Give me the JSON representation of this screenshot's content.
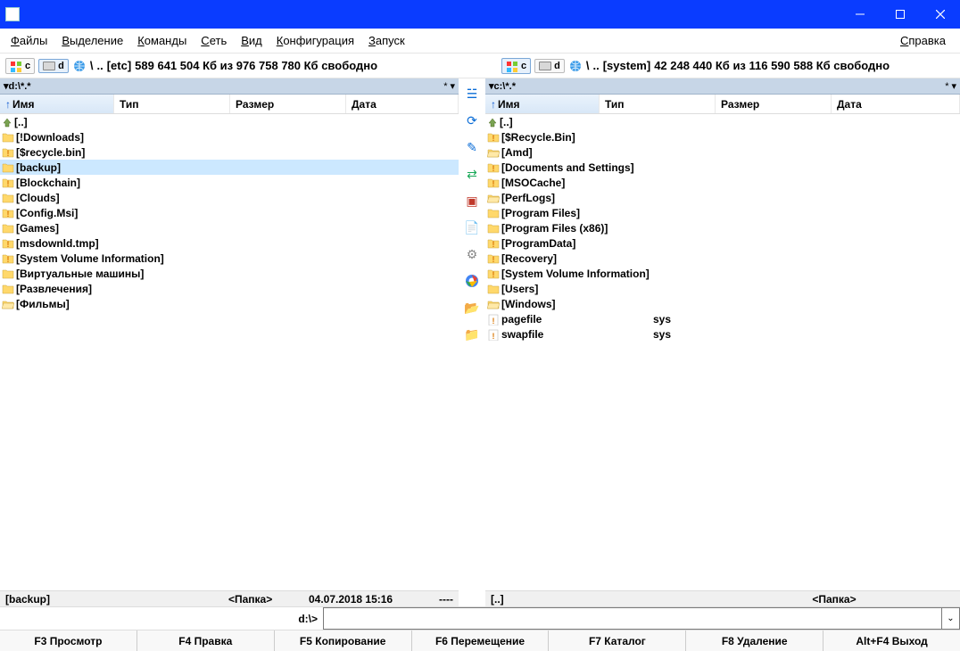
{
  "titlebar": {
    "title": ""
  },
  "menu": {
    "file": "Файлы",
    "select": "Выделение",
    "commands": "Команды",
    "net": "Сеть",
    "view": "Вид",
    "config": "Конфигурация",
    "start": "Запуск",
    "help": "Справка"
  },
  "drivebar_left": {
    "label_c": "c",
    "label_d": "d",
    "breadcrumb": "\\",
    "subdir": "..",
    "name": "[etc]",
    "space": "589 641 504 Кб из 976 758 780 Кб свободно"
  },
  "drivebar_right": {
    "label_c": "c",
    "label_d": "d",
    "breadcrumb": "\\",
    "subdir": "..",
    "name": "[system]",
    "space": "42 248 440 Кб из 116 590 588 Кб свободно"
  },
  "panel_left": {
    "path": "d:\\*.*",
    "cols": {
      "name": "Имя",
      "type": "Тип",
      "size": "Размер",
      "date": "Дата"
    },
    "up": "[..]",
    "rows": [
      {
        "name": "[!Downloads]",
        "sel": false,
        "icon": "folder"
      },
      {
        "name": "[$recycle.bin]",
        "sel": false,
        "icon": "folder-excl"
      },
      {
        "name": "[backup]",
        "sel": true,
        "icon": "folder"
      },
      {
        "name": "[Blockchain]",
        "sel": false,
        "icon": "folder-excl"
      },
      {
        "name": "[Clouds]",
        "sel": false,
        "icon": "folder"
      },
      {
        "name": "[Config.Msi]",
        "sel": false,
        "icon": "folder-excl"
      },
      {
        "name": "[Games]",
        "sel": false,
        "icon": "folder"
      },
      {
        "name": "[msdownld.tmp]",
        "sel": false,
        "icon": "folder-excl"
      },
      {
        "name": "[System Volume Information]",
        "sel": false,
        "icon": "folder-excl"
      },
      {
        "name": "[Виртуальные машины]",
        "sel": false,
        "icon": "folder"
      },
      {
        "name": "[Развлечения]",
        "sel": false,
        "icon": "folder"
      },
      {
        "name": "[Фильмы]",
        "sel": false,
        "icon": "folder-open"
      }
    ],
    "status": {
      "name": "[backup]",
      "size": "<Папка>",
      "date": "04.07.2018 15:16",
      "attr": "----"
    }
  },
  "panel_right": {
    "path": "c:\\*.*",
    "cols": {
      "name": "Имя",
      "type": "Тип",
      "size": "Размер",
      "date": "Дата"
    },
    "up": "[..]",
    "rows": [
      {
        "name": "[$Recycle.Bin]",
        "icon": "folder-excl"
      },
      {
        "name": "[Amd]",
        "icon": "folder-open"
      },
      {
        "name": "[Documents and Settings]",
        "icon": "folder-excl"
      },
      {
        "name": "[MSOCache]",
        "icon": "folder-excl"
      },
      {
        "name": "[PerfLogs]",
        "icon": "folder-open"
      },
      {
        "name": "[Program Files]",
        "icon": "folder"
      },
      {
        "name": "[Program Files (x86)]",
        "icon": "folder"
      },
      {
        "name": "[ProgramData]",
        "icon": "folder-excl"
      },
      {
        "name": "[Recovery]",
        "icon": "folder-excl"
      },
      {
        "name": "[System Volume Information]",
        "icon": "folder-excl"
      },
      {
        "name": "[Users]",
        "icon": "folder"
      },
      {
        "name": "[Windows]",
        "icon": "folder-open"
      },
      {
        "name": "pagefile",
        "type": "sys",
        "icon": "file-excl"
      },
      {
        "name": "swapfile",
        "type": "sys",
        "icon": "file-excl"
      }
    ],
    "status": {
      "name": "[..]",
      "size": "<Папка>",
      "date": "",
      "attr": ""
    }
  },
  "cmd": {
    "prompt": "d:\\>",
    "value": ""
  },
  "fn": {
    "f3": "F3 Просмотр",
    "f4": "F4 Правка",
    "f5": "F5 Копирование",
    "f6": "F6 Перемещение",
    "f7": "F7 Каталог",
    "f8": "F8 Удаление",
    "altf4": "Alt+F4 Выход"
  }
}
